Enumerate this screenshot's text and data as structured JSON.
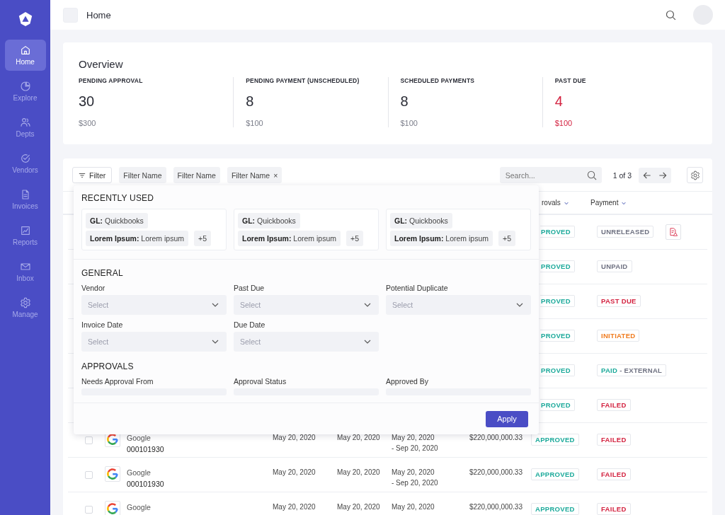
{
  "sidebar": {
    "items": [
      {
        "label": "Home",
        "selected": true
      },
      {
        "label": "Explore",
        "selected": false
      },
      {
        "label": "Depts",
        "selected": false
      },
      {
        "label": "Vendors",
        "selected": false
      },
      {
        "label": "Invoices",
        "selected": false
      },
      {
        "label": "Reports",
        "selected": false
      },
      {
        "label": "Inbox",
        "selected": false
      },
      {
        "label": "Manage",
        "selected": false
      }
    ]
  },
  "topbar": {
    "title": "Home"
  },
  "overview": {
    "title": "Overview",
    "stats": [
      {
        "label": "PENDING APPROVAL",
        "count": "30",
        "amount": "$300",
        "alert": false
      },
      {
        "label": "PENDING PAYMENT (UNSCHEDULED)",
        "count": "8",
        "amount": "$100",
        "alert": false
      },
      {
        "label": "SCHEDULED PAYMENTS",
        "count": "8",
        "amount": "$100",
        "alert": false
      },
      {
        "label": "PAST DUE",
        "count": "4",
        "amount": "$100",
        "alert": true
      }
    ]
  },
  "toolbar": {
    "filter_button": "Filter",
    "chips": [
      {
        "label": "Filter Name",
        "removable": false
      },
      {
        "label": "Filter Name",
        "removable": false
      },
      {
        "label": "Filter Name",
        "removable": true,
        "remove": "×"
      }
    ],
    "search": {
      "placeholder": "Search..."
    },
    "page": "1 of 3"
  },
  "table": {
    "columns": [
      {
        "label": "rovals"
      },
      {
        "label": "Payment"
      }
    ],
    "rows": [
      {
        "approval": "PROVED",
        "payment": {
          "label": "UNRELEASED",
          "kind": "unreleased"
        },
        "flagged": true
      },
      {
        "approval": "PROVED",
        "payment": {
          "label": "UNPAID",
          "kind": "unpaid"
        },
        "flagged": false
      },
      {
        "approval": "PROVED",
        "payment": {
          "label": "PAST DUE",
          "kind": "past_due"
        },
        "flagged": false
      },
      {
        "approval": "PROVED",
        "payment": {
          "label": "INITIATED",
          "kind": "initiated"
        },
        "flagged": false
      },
      {
        "approval": "PROVED",
        "payment": {
          "label": "PAID",
          "detail": "- EXTERNAL",
          "kind": "paid"
        },
        "flagged": false
      },
      {
        "approval": "PROVED",
        "payment": {
          "label": "FAILED",
          "kind": "failed"
        },
        "flagged": false
      },
      {
        "checked": false,
        "vendor": "Google",
        "invoice": "000101930",
        "invoice_date": "May 20, 2020",
        "due_date": "May 20, 2020",
        "period": "May 20, 2020",
        "period_end": "- Sep 20, 2020",
        "amount": "$220,000,000.33",
        "approval": "APPROVED",
        "payment": {
          "label": "FAILED",
          "kind": "failed"
        },
        "flagged": false
      },
      {
        "checked": false,
        "vendor": "Google",
        "invoice": "000101930",
        "invoice_date": "May 20, 2020",
        "due_date": "May 20, 2020",
        "period": "May 20, 2020",
        "period_end": "- Sep 20, 2020",
        "amount": "$220,000,000.33",
        "approval": "APPROVED",
        "payment": {
          "label": "FAILED",
          "kind": "failed"
        },
        "flagged": false
      },
      {
        "checked": false,
        "vendor": "Google",
        "invoice_date": "May 20, 2020",
        "due_date": "May 20, 2020",
        "period": "May 20, 2020",
        "amount": "$220,000,000.33",
        "approval": "APPROVED",
        "payment": {
          "label": "FAILED",
          "kind": "failed"
        },
        "flagged": false
      }
    ]
  },
  "filter_panel": {
    "recent_title": "RECENTLY USED",
    "recent": [
      {
        "tags": [
          {
            "key": "GL:",
            "value": "Quickbooks"
          },
          {
            "key": "Lorem Ipsum:",
            "value": "Lorem ipsum"
          }
        ],
        "more": "+5"
      },
      {
        "tags": [
          {
            "key": "GL:",
            "value": "Quickbooks"
          },
          {
            "key": "Lorem Ipsum:",
            "value": "Lorem ipsum"
          }
        ],
        "more": "+5"
      },
      {
        "tags": [
          {
            "key": "GL:",
            "value": "Quickbooks"
          },
          {
            "key": "Lorem Ipsum:",
            "value": "Lorem ipsum"
          }
        ],
        "more": "+5"
      }
    ],
    "sections": [
      {
        "title": "GENERAL",
        "fields": [
          {
            "label": "Vendor",
            "placeholder": "Select"
          },
          {
            "label": "Past Due",
            "placeholder": "Select"
          },
          {
            "label": "Potential Duplicate",
            "placeholder": "Select"
          },
          {
            "label": "Invoice Date",
            "placeholder": "Select"
          },
          {
            "label": "Due Date",
            "placeholder": "Select"
          }
        ]
      },
      {
        "title": "APPROVALS",
        "fields": [
          {
            "label": "Needs Approval From"
          },
          {
            "label": "Approval Status"
          },
          {
            "label": "Approved By"
          }
        ]
      }
    ],
    "apply": "Apply"
  }
}
